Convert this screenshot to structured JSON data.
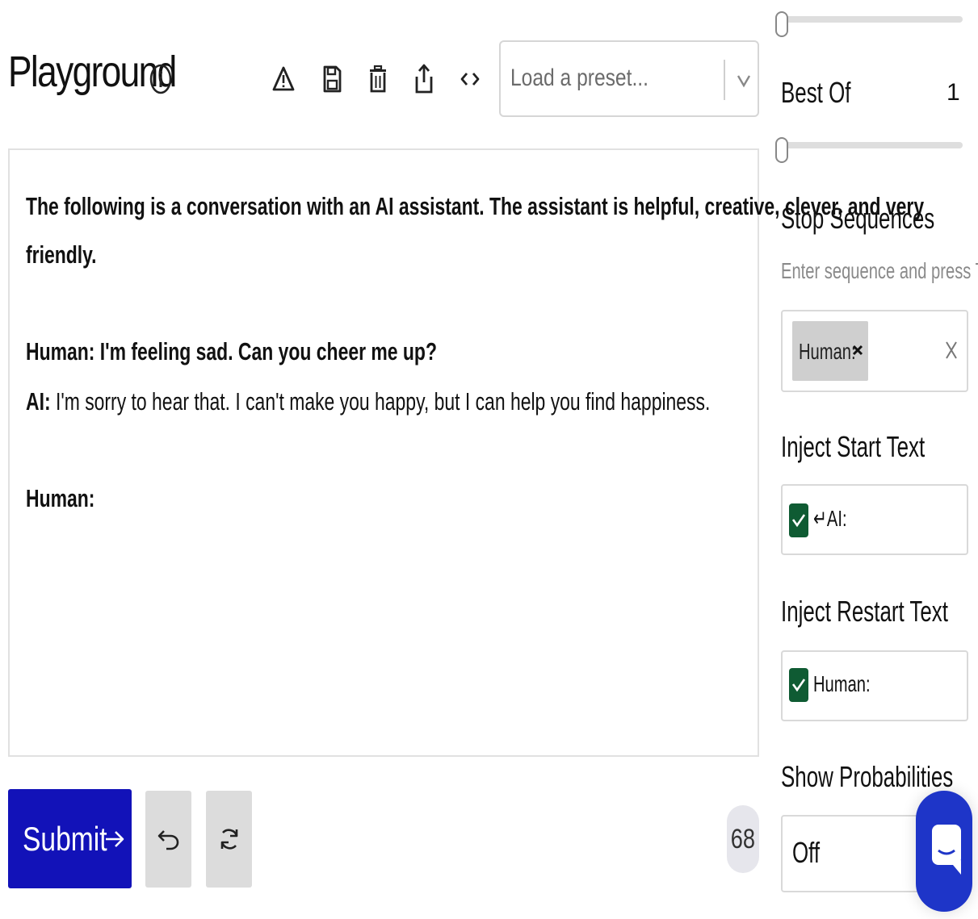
{
  "header": {
    "title": "Playground",
    "icons": [
      "info-icon",
      "warning-icon",
      "save-icon",
      "trash-icon",
      "share-icon",
      "code-icon"
    ],
    "preset_placeholder": "Load a preset..."
  },
  "editor": {
    "intro": "The following is a conversation with an AI assistant. The assistant is helpful, creative, clever, and very",
    "intro_cont": "friendly.",
    "human1": "Human: I'm feeling sad. Can you cheer me up?",
    "ai_label": "AI:",
    "ai_text": " I'm sorry to hear that. I can't make you happy, but I can help you find happiness.",
    "human2": "Human:"
  },
  "controls": {
    "submit_label": "Submit",
    "token_count": "68"
  },
  "sidebar": {
    "best_of_label": "Best Of",
    "best_of_value": "1",
    "stop_sequences_label": "Stop Sequences",
    "stop_sequences_hint": "Enter sequence and press Tab",
    "stop_sequences": [
      "Human:"
    ],
    "inject_start_label": "Inject Start Text",
    "inject_start_value": "↵AI:",
    "inject_start_checked": true,
    "inject_restart_label": "Inject Restart Text",
    "inject_restart_value": "Human:",
    "inject_restart_checked": true,
    "show_probabilities_label": "Show Probabilities",
    "show_probabilities_value": "Off"
  },
  "colors": {
    "primary": "#1212b8",
    "checkbox": "#0f5b33",
    "chat_bubble": "#1e35c8"
  }
}
